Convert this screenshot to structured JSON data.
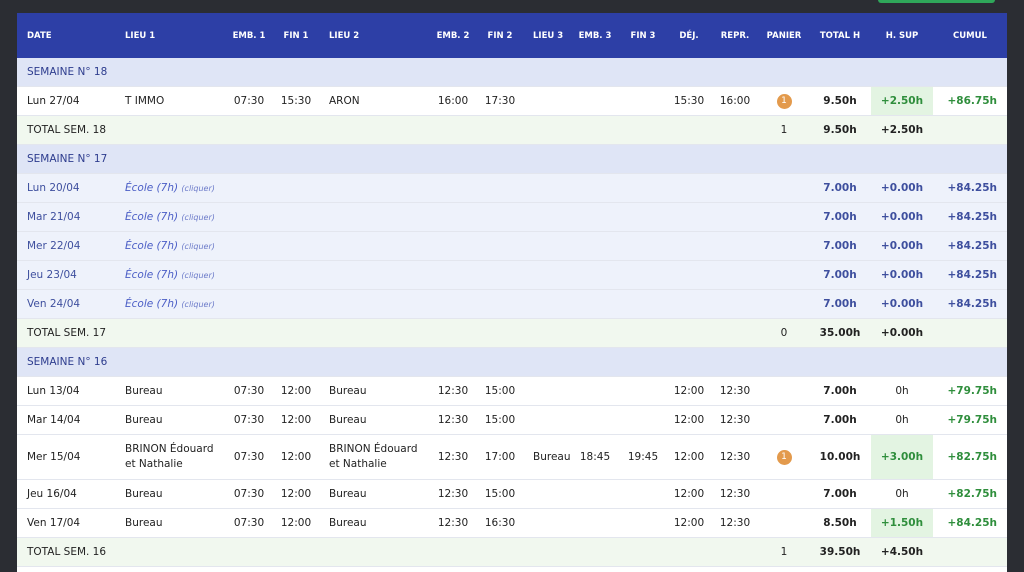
{
  "columns": [
    "DATE",
    "LIEU 1",
    "EMB. 1",
    "FIN 1",
    "LIEU 2",
    "EMB. 2",
    "FIN 2",
    "LIEU 3",
    "EMB. 3",
    "FIN 3",
    "DÉJ.",
    "REPR.",
    "PANIER",
    "TOTAL H",
    "H. SUP",
    "CUMUL"
  ],
  "ecole_hint": "(cliquer)",
  "weeks": [
    {
      "title": "SEMAINE N° 18",
      "rows": [
        {
          "date": "Lun 27/04",
          "lieu1": "T IMMO",
          "emb1": "07:30",
          "fin1": "15:30",
          "lieu2": "ARON",
          "emb2": "16:00",
          "fin2": "17:30",
          "lieu3": "",
          "emb3": "",
          "fin3": "",
          "dej": "15:30",
          "repr": "16:00",
          "panier": "1",
          "total": "9.50h",
          "hsup": "+2.50h",
          "cumul": "+86.75h"
        }
      ],
      "total": {
        "label": "TOTAL SEM. 18",
        "panier": "1",
        "total": "9.50h",
        "hsup": "+2.50h"
      }
    },
    {
      "title": "SEMAINE N° 17",
      "rows": [
        {
          "date": "Lun 20/04",
          "ecole": "École (7h)",
          "total": "7.00h",
          "hsup": "+0.00h",
          "cumul": "+84.25h"
        },
        {
          "date": "Mar 21/04",
          "ecole": "École (7h)",
          "total": "7.00h",
          "hsup": "+0.00h",
          "cumul": "+84.25h"
        },
        {
          "date": "Mer 22/04",
          "ecole": "École (7h)",
          "total": "7.00h",
          "hsup": "+0.00h",
          "cumul": "+84.25h"
        },
        {
          "date": "Jeu 23/04",
          "ecole": "École (7h)",
          "total": "7.00h",
          "hsup": "+0.00h",
          "cumul": "+84.25h"
        },
        {
          "date": "Ven 24/04",
          "ecole": "École (7h)",
          "total": "7.00h",
          "hsup": "+0.00h",
          "cumul": "+84.25h"
        }
      ],
      "total": {
        "label": "TOTAL SEM. 17",
        "panier": "0",
        "total": "35.00h",
        "hsup": "+0.00h"
      }
    },
    {
      "title": "SEMAINE N° 16",
      "rows": [
        {
          "date": "Lun 13/04",
          "lieu1": "Bureau",
          "emb1": "07:30",
          "fin1": "12:00",
          "lieu2": "Bureau",
          "emb2": "12:30",
          "fin2": "15:00",
          "lieu3": "",
          "emb3": "",
          "fin3": "",
          "dej": "12:00",
          "repr": "12:30",
          "panier": "",
          "total": "7.00h",
          "hsup": "0h",
          "cumul": "+79.75h"
        },
        {
          "date": "Mar 14/04",
          "lieu1": "Bureau",
          "emb1": "07:30",
          "fin1": "12:00",
          "lieu2": "Bureau",
          "emb2": "12:30",
          "fin2": "15:00",
          "lieu3": "",
          "emb3": "",
          "fin3": "",
          "dej": "12:00",
          "repr": "12:30",
          "panier": "",
          "total": "7.00h",
          "hsup": "0h",
          "cumul": "+79.75h"
        },
        {
          "date": "Mer 15/04",
          "lieu1": "BRINON Édouard et Nathalie",
          "emb1": "07:30",
          "fin1": "12:00",
          "lieu2": "BRINON Édouard et Nathalie",
          "emb2": "12:30",
          "fin2": "17:00",
          "lieu3": "Bureau",
          "emb3": "18:45",
          "fin3": "19:45",
          "dej": "12:00",
          "repr": "12:30",
          "panier": "1",
          "total": "10.00h",
          "hsup": "+3.00h",
          "cumul": "+82.75h"
        },
        {
          "date": "Jeu 16/04",
          "lieu1": "Bureau",
          "emb1": "07:30",
          "fin1": "12:00",
          "lieu2": "Bureau",
          "emb2": "12:30",
          "fin2": "15:00",
          "lieu3": "",
          "emb3": "",
          "fin3": "",
          "dej": "12:00",
          "repr": "12:30",
          "panier": "",
          "total": "7.00h",
          "hsup": "0h",
          "cumul": "+82.75h"
        },
        {
          "date": "Ven 17/04",
          "lieu1": "Bureau",
          "emb1": "07:30",
          "fin1": "12:00",
          "lieu2": "Bureau",
          "emb2": "12:30",
          "fin2": "16:30",
          "lieu3": "",
          "emb3": "",
          "fin3": "",
          "dej": "12:00",
          "repr": "12:30",
          "panier": "",
          "total": "8.50h",
          "hsup": "+1.50h",
          "cumul": "+84.25h"
        }
      ],
      "total": {
        "label": "TOTAL SEM. 16",
        "panier": "1",
        "total": "39.50h",
        "hsup": "+4.50h"
      }
    }
  ]
}
